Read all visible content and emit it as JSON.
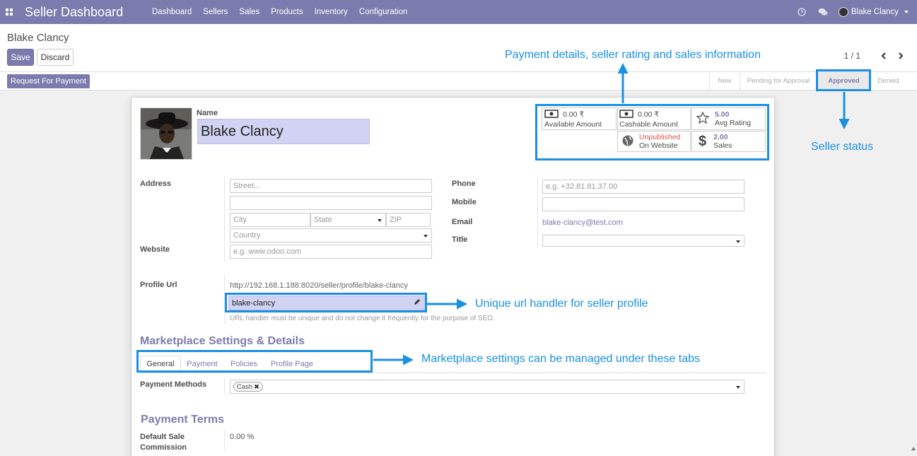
{
  "navbar": {
    "brand": "Seller Dashboard",
    "menu": [
      "Dashboard",
      "Sellers",
      "Sales",
      "Products",
      "Inventory",
      "Configuration"
    ],
    "user": "Blake Clancy"
  },
  "control_panel": {
    "breadcrumb": "Blake Clancy",
    "save_label": "Save",
    "discard_label": "Discard",
    "pager": "1 / 1"
  },
  "statusbar": {
    "request_button": "Request For Payment",
    "stages": [
      "New",
      "Pending for Approval",
      "Approved",
      "Denied"
    ],
    "active_stage": "Approved"
  },
  "form": {
    "name_label": "Name",
    "name_value": "Blake Clancy",
    "stats": {
      "available_amount": "0.00 ₹",
      "available_label": "Available Amount",
      "cashable_amount": "0.00 ₹",
      "cashable_label": "Cashable Amount",
      "avg_rating": "5.00",
      "avg_rating_label": "Avg Rating",
      "website_status": "Unpublished",
      "website_label": "On Website",
      "sales_count": "2.00",
      "sales_label": "Sales"
    },
    "address_label": "Address",
    "street_placeholder": "Street...",
    "city_placeholder": "City",
    "state_placeholder": "State",
    "zip_placeholder": "ZIP",
    "country_placeholder": "Country",
    "website_label": "Website",
    "website_placeholder": "e.g. www.odoo.com",
    "phone_label": "Phone",
    "phone_placeholder": "e.g. +32.81.81.37.00",
    "mobile_label": "Mobile",
    "email_label": "Email",
    "email_value": "blake-clancy@test.com",
    "title_label": "Title",
    "profile_url_label": "Profile Url",
    "profile_url_value": "http://192.168.1.188:8020/seller/profile/blake-clancy",
    "url_handler_value": "blake-clancy",
    "url_handler_help": "URL handler must be unique and do not change it frequently for the purpose of SEO.",
    "marketplace_title": "Marketplace Settings & Details",
    "tabs": [
      "General",
      "Payment",
      "Policies",
      "Profile Page"
    ],
    "active_tab": "General",
    "payment_methods_label": "Payment Methods",
    "payment_method_tag": "Cash",
    "payment_terms_title": "Payment Terms",
    "default_commission_label_line1": "Default Sale",
    "default_commission_label_line2": "Commission",
    "default_commission_value": "0.00 %"
  },
  "annotations": {
    "payment_details": "Payment details, seller rating and sales information",
    "seller_status": "Seller status",
    "url_handler": "Unique url handler for seller profile",
    "marketplace_tabs": "Marketplace settings can be managed under these tabs",
    "color": "#1a8fe3"
  },
  "colors": {
    "brand": "#7c7bad",
    "name_field_bg": "#d2d3f3",
    "unpublished": "#d9534f"
  }
}
